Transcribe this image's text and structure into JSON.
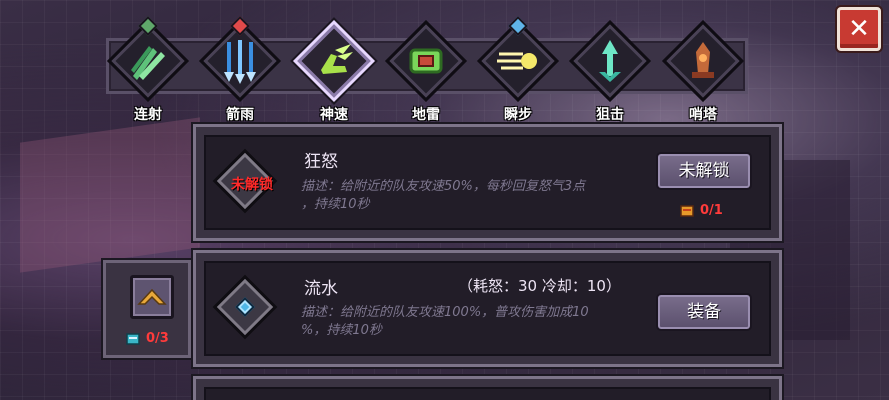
{
  "skills": [
    {
      "label": "连射",
      "gem_color": "#5fa86a",
      "icon": "triple-arrow-icon",
      "active": false
    },
    {
      "label": "箭雨",
      "gem_color": "#e04a4a",
      "icon": "arrow-rain-icon",
      "active": false
    },
    {
      "label": "神速",
      "gem_color": "",
      "icon": "winged-boot-icon",
      "active": true
    },
    {
      "label": "地雷",
      "gem_color": "",
      "icon": "landmine-icon",
      "active": false
    },
    {
      "label": "瞬步",
      "gem_color": "#5fb4e8",
      "icon": "dash-icon",
      "active": false
    },
    {
      "label": "狙击",
      "gem_color": "",
      "icon": "snipe-arrow-icon",
      "active": false
    },
    {
      "label": "哨塔",
      "gem_color": "",
      "icon": "sentry-tower-icon",
      "active": false
    }
  ],
  "close_label": "✕",
  "talents": [
    {
      "name": "狂怒",
      "badge_label": "未解锁",
      "badge_gem_color": "",
      "cost": "",
      "description_line1": "描述：给附近的队友攻速50%，每秒回复怒气3点",
      "description_line2": "，持续10秒",
      "button_label": "未解锁",
      "requirement": "0/1",
      "requirement_color": "#ff3b3b"
    },
    {
      "name": "流水",
      "badge_label": "",
      "badge_gem_color": "#4fb6e6",
      "cost": "（耗怒：30  冷却：10）",
      "description_line1": "描述：给附近的队友攻速100%，普攻伤害加成10",
      "description_line2": "%，持续10秒",
      "button_label": "装备",
      "requirement": "",
      "requirement_color": "#ff3b3b"
    }
  ],
  "upgrade": {
    "requirement": "0/3",
    "requirement_color": "#ff3b3b"
  },
  "colors": {
    "panel_border": "#7d7489",
    "accent_red": "#ff3b3b",
    "close_red": "#c83a32"
  }
}
